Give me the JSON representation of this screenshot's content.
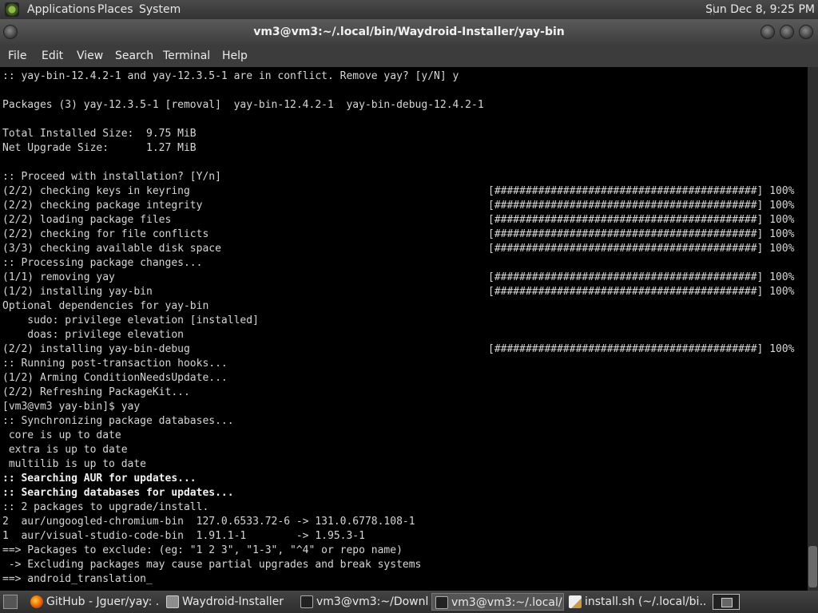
{
  "top_panel": {
    "menus": [
      "Applications",
      "Places",
      "System"
    ],
    "clock": "Sun Dec  8,  9:25 PM"
  },
  "window": {
    "title": "vm3@vm3:~/.local/bin/Waydroid-Installer/yay-bin",
    "menu": [
      "File",
      "Edit",
      "View",
      "Search",
      "Terminal",
      "Help"
    ]
  },
  "terminal": {
    "lines": [
      {
        "text": ":: yay-bin-12.4.2-1 and yay-12.3.5-1 are in conflict. Remove yay? [y/N] y",
        "bold": false,
        "progress": ""
      },
      {
        "text": "",
        "bold": false,
        "progress": ""
      },
      {
        "text": "Packages (3) yay-12.3.5-1 [removal]  yay-bin-12.4.2-1  yay-bin-debug-12.4.2-1",
        "bold": false,
        "progress": ""
      },
      {
        "text": "",
        "bold": false,
        "progress": ""
      },
      {
        "text": "Total Installed Size:  9.75 MiB",
        "bold": false,
        "progress": ""
      },
      {
        "text": "Net Upgrade Size:      1.27 MiB",
        "bold": false,
        "progress": ""
      },
      {
        "text": "",
        "bold": false,
        "progress": ""
      },
      {
        "text": ":: Proceed with installation? [Y/n]",
        "bold": false,
        "progress": ""
      },
      {
        "text": "(2/2) checking keys in keyring",
        "bold": false,
        "progress": "[##########################################] 100%"
      },
      {
        "text": "(2/2) checking package integrity",
        "bold": false,
        "progress": "[##########################################] 100%"
      },
      {
        "text": "(2/2) loading package files",
        "bold": false,
        "progress": "[##########################################] 100%"
      },
      {
        "text": "(2/2) checking for file conflicts",
        "bold": false,
        "progress": "[##########################################] 100%"
      },
      {
        "text": "(3/3) checking available disk space",
        "bold": false,
        "progress": "[##########################################] 100%"
      },
      {
        "text": ":: Processing package changes...",
        "bold": false,
        "progress": ""
      },
      {
        "text": "(1/1) removing yay",
        "bold": false,
        "progress": "[##########################################] 100%"
      },
      {
        "text": "(1/2) installing yay-bin",
        "bold": false,
        "progress": "[##########################################] 100%"
      },
      {
        "text": "Optional dependencies for yay-bin",
        "bold": false,
        "progress": ""
      },
      {
        "text": "    sudo: privilege elevation [installed]",
        "bold": false,
        "progress": ""
      },
      {
        "text": "    doas: privilege elevation",
        "bold": false,
        "progress": ""
      },
      {
        "text": "(2/2) installing yay-bin-debug",
        "bold": false,
        "progress": "[##########################################] 100%"
      },
      {
        "text": ":: Running post-transaction hooks...",
        "bold": false,
        "progress": ""
      },
      {
        "text": "(1/2) Arming ConditionNeedsUpdate...",
        "bold": false,
        "progress": ""
      },
      {
        "text": "(2/2) Refreshing PackageKit...",
        "bold": false,
        "progress": ""
      },
      {
        "text": "[vm3@vm3 yay-bin]$ yay",
        "bold": false,
        "progress": ""
      },
      {
        "text": ":: Synchronizing package databases...",
        "bold": false,
        "progress": ""
      },
      {
        "text": " core is up to date",
        "bold": false,
        "progress": ""
      },
      {
        "text": " extra is up to date",
        "bold": false,
        "progress": ""
      },
      {
        "text": " multilib is up to date",
        "bold": false,
        "progress": ""
      },
      {
        "text": ":: Searching AUR for updates...",
        "bold": true,
        "progress": ""
      },
      {
        "text": ":: Searching databases for updates...",
        "bold": true,
        "progress": ""
      },
      {
        "text": ":: 2 packages to upgrade/install.",
        "bold": false,
        "progress": ""
      },
      {
        "text": "2  aur/ungoogled-chromium-bin  127.0.6533.72-6 -> 131.0.6778.108-1",
        "bold": false,
        "progress": ""
      },
      {
        "text": "1  aur/visual-studio-code-bin  1.91.1-1        -> 1.95.3-1",
        "bold": false,
        "progress": ""
      },
      {
        "text": "==> Packages to exclude: (eg: \"1 2 3\", \"1-3\", \"^4\" or repo name)",
        "bold": false,
        "progress": ""
      },
      {
        "text": " -> Excluding packages may cause partial upgrades and break systems",
        "bold": false,
        "progress": ""
      },
      {
        "text": "==> android_translation_",
        "bold": false,
        "progress": ""
      }
    ]
  },
  "taskbar": {
    "items": [
      {
        "label": "GitHub - Jguer/yay: ...",
        "icon": "firefox-icon",
        "active": false
      },
      {
        "label": "Waydroid-Installer",
        "icon": "folder-icon",
        "active": false
      },
      {
        "label": "vm3@vm3:~/Downl...",
        "icon": "terminal-icon",
        "active": false
      },
      {
        "label": "vm3@vm3:~/.local/...",
        "icon": "terminal-icon",
        "active": true
      },
      {
        "label": "install.sh (~/.local/bi...",
        "icon": "text-editor-icon",
        "active": false
      }
    ]
  },
  "colors": {
    "terminal_bg": "#000000",
    "terminal_fg": "#d6d6d6",
    "panel": "#3c3c3c"
  }
}
